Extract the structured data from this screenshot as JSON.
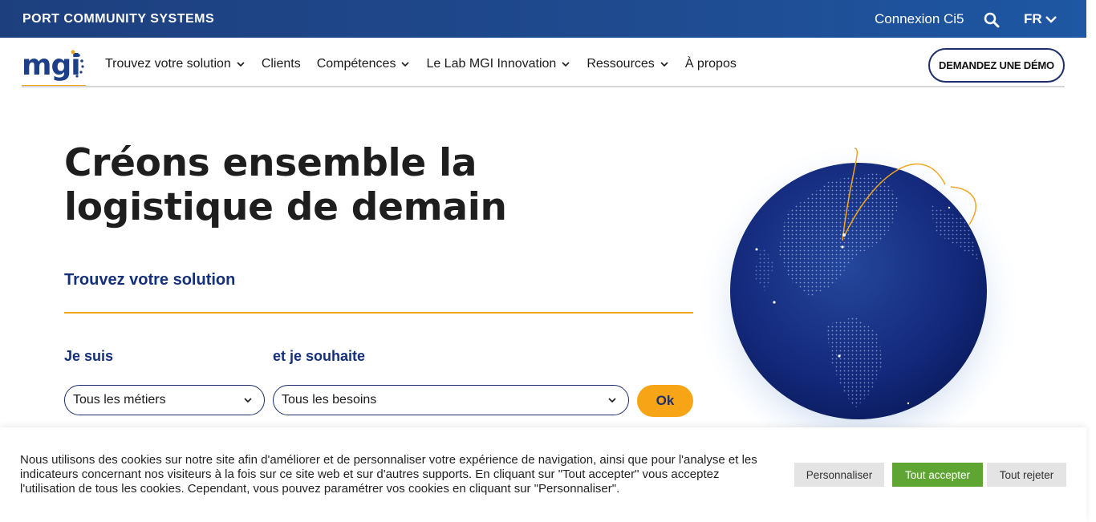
{
  "topbar": {
    "brand": "PORT COMMUNITY SYSTEMS",
    "login": "Connexion Ci5",
    "lang": "FR"
  },
  "nav": {
    "logo_text": "mgi",
    "items": [
      {
        "label": "Trouvez votre solution",
        "has_dropdown": true
      },
      {
        "label": "Clients",
        "has_dropdown": false
      },
      {
        "label": "Compétences",
        "has_dropdown": true
      },
      {
        "label": "Le Lab MGI Innovation",
        "has_dropdown": true
      },
      {
        "label": "Ressources",
        "has_dropdown": true
      },
      {
        "label": "À propos",
        "has_dropdown": false
      }
    ],
    "demo_label": "DEMANDEZ UNE DÉMO"
  },
  "hero": {
    "title": "Créons ensemble la logistique de demain",
    "finder_title": "Trouvez votre solution",
    "label_a": "Je suis",
    "label_b": "et je souhaite",
    "select_a": "Tous les métiers",
    "select_b": "Tous les besoins",
    "ok": "Ok"
  },
  "cookie": {
    "text": "Nous utilisons des cookies sur notre site afin d'améliorer et de personnaliser votre expérience de navigation, ainsi que pour l'analyse et les indicateurs concernant nos visiteurs à la fois sur ce site web et sur d'autres supports. En cliquant sur \"Tout accepter\" vous acceptez l'utilisation de tous les cookies. Cependant, vous pouvez paramétrer vos cookies en cliquant sur \"Personnaliser\".",
    "customize": "Personnaliser",
    "accept": "Tout accepter",
    "reject": "Tout rejeter"
  },
  "colors": {
    "primary": "#1d3f88",
    "accent": "#f8a417",
    "accept_green": "#5fa533"
  }
}
